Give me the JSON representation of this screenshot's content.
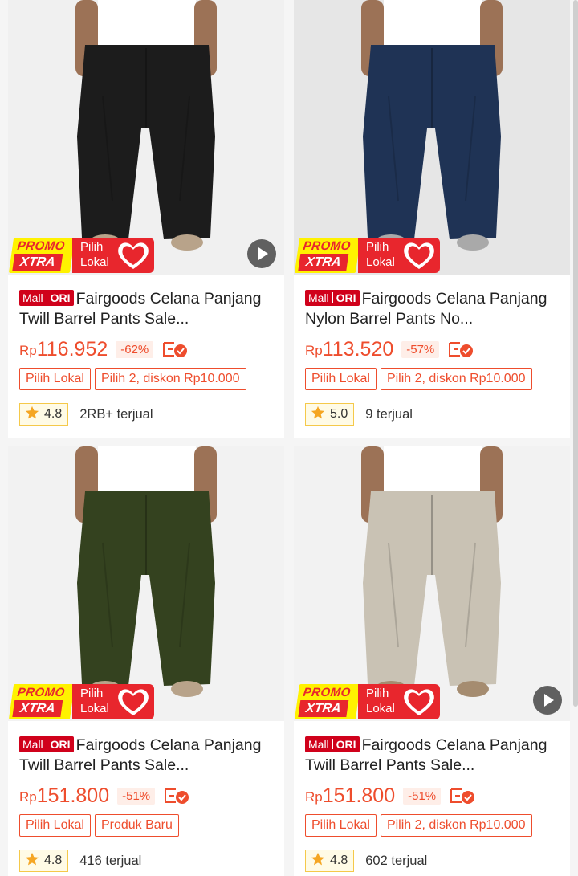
{
  "products": [
    {
      "mall_label": "Mall",
      "ori_label": "ORI",
      "title": "Fairgoods Celana Panjang Twill Barrel Pants Sale...",
      "currency": "Rp",
      "price": "116.952",
      "discount": "-62%",
      "tags": [
        "Pilih Lokal",
        "Pilih 2, diskon Rp10.000"
      ],
      "rating": "4.8",
      "sold": "2RB+ terjual",
      "pants_color": "#1c1c1c",
      "has_video": true
    },
    {
      "mall_label": "Mall",
      "ori_label": "ORI",
      "title": "Fairgoods Celana Panjang Nylon Barrel Pants No...",
      "currency": "Rp",
      "price": "113.520",
      "discount": "-57%",
      "tags": [
        "Pilih Lokal",
        "Pilih 2, diskon Rp10.000"
      ],
      "rating": "5.0",
      "sold": "9 terjual",
      "pants_color": "#1f3355",
      "has_video": false
    },
    {
      "mall_label": "Mall",
      "ori_label": "ORI",
      "title": "Fairgoods Celana Panjang Twill Barrel Pants Sale...",
      "currency": "Rp",
      "price": "151.800",
      "discount": "-51%",
      "tags": [
        "Pilih Lokal",
        "Produk Baru"
      ],
      "rating": "4.8",
      "sold": "416 terjual",
      "pants_color": "#34421f",
      "has_video": false
    },
    {
      "mall_label": "Mall",
      "ori_label": "ORI",
      "title": "Fairgoods Celana Panjang Twill Barrel Pants Sale...",
      "currency": "Rp",
      "price": "151.800",
      "discount": "-51%",
      "tags": [
        "Pilih Lokal",
        "Pilih 2, diskon Rp10.000"
      ],
      "rating": "4.8",
      "sold": "602 terjual",
      "pants_color": "#c9c2b4",
      "has_video": true
    }
  ],
  "banner": {
    "promo_line1": "PROMO",
    "promo_line2": "XTRA",
    "lokal_line1": "Pilih",
    "lokal_line2": "Lokal"
  },
  "colors": {
    "accent": "#ee4d2d",
    "mall_red": "#d0011b",
    "promo_yellow": "#fff200",
    "lokal_red": "#e8262d"
  }
}
